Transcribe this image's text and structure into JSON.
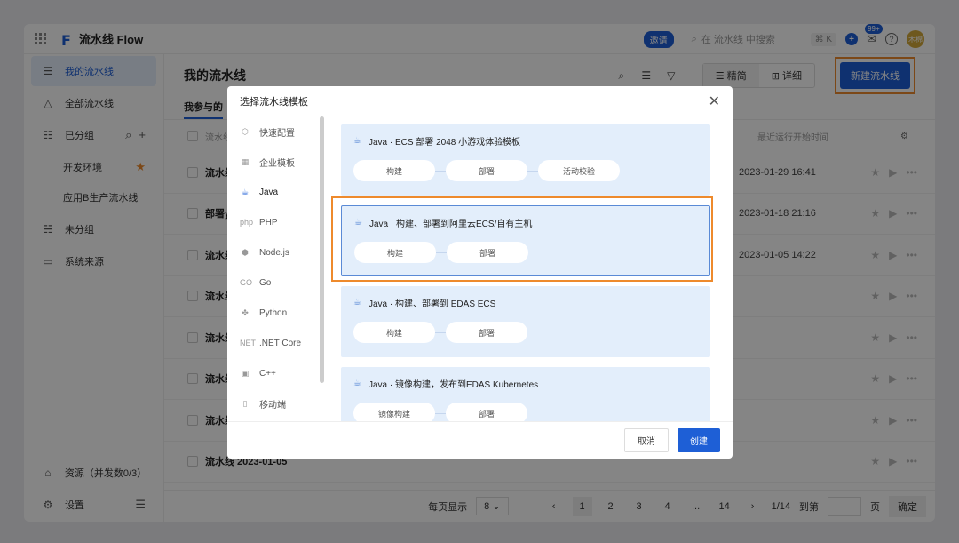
{
  "app": {
    "title": "流水线 Flow"
  },
  "topbar": {
    "invite": "邀请",
    "search_placeholder": "在 流水线 中搜索",
    "shortcut": "⌘ K",
    "notif_count": "99+",
    "avatar_text": "木棉"
  },
  "sidebar": {
    "items": [
      {
        "label": "我的流水线"
      },
      {
        "label": "全部流水线"
      },
      {
        "label": "已分组"
      },
      {
        "label": "开发环境"
      },
      {
        "label": "应用B生产流水线"
      },
      {
        "label": "未分组"
      },
      {
        "label": "系统来源"
      }
    ],
    "resource_label": "资源（并发数0/3）",
    "settings_label": "设置"
  },
  "main": {
    "title": "我的流水线",
    "view_simple": "精简",
    "view_detail": "详细",
    "new_button": "新建流水线",
    "tab_participate": "我参与的",
    "col_name": "流水线",
    "col_last_run": "最近运行开始时间",
    "rows": [
      {
        "name": "流水线",
        "time": "2023-01-29 16:41"
      },
      {
        "name": "部署y",
        "time": "2023-01-18 21:16"
      },
      {
        "name": "流水线",
        "time": "2023-01-05 14:22"
      },
      {
        "name": "流水线",
        "time": ""
      },
      {
        "name": "流水线",
        "time": ""
      },
      {
        "name": "流水线",
        "time": ""
      },
      {
        "name": "流水线",
        "time": ""
      },
      {
        "name": "流水线 2023-01-05",
        "time": ""
      }
    ],
    "pagination": {
      "page_size_label": "每页显示",
      "page_size": "8",
      "pages": [
        "1",
        "2",
        "3",
        "4",
        "...",
        "14"
      ],
      "page_info": "1/14",
      "jump_label": "到第",
      "page_unit": "页",
      "confirm": "确定"
    }
  },
  "modal": {
    "title": "选择流水线模板",
    "categories": [
      {
        "label": "快速配置",
        "icon": "⬡"
      },
      {
        "label": "企业模板",
        "icon": "▦"
      },
      {
        "label": "Java",
        "icon": "☕"
      },
      {
        "label": "PHP",
        "icon": "php"
      },
      {
        "label": "Node.js",
        "icon": "⬢"
      },
      {
        "label": "Go",
        "icon": "GO"
      },
      {
        "label": "Python",
        "icon": "✤"
      },
      {
        "label": ".NET Core",
        "icon": "NET"
      },
      {
        "label": "C++",
        "icon": "▣"
      },
      {
        "label": "移动端",
        "icon": "▯"
      }
    ],
    "templates": [
      {
        "title": "Java · ECS 部署 2048 小游戏体验模板",
        "steps": [
          "构建",
          "部署",
          "活动校验"
        ]
      },
      {
        "title": "Java · 构建、部署到阿里云ECS/自有主机",
        "steps": [
          "构建",
          "部署"
        ]
      },
      {
        "title": "Java · 构建、部署到 EDAS ECS",
        "steps": [
          "构建",
          "部署"
        ]
      },
      {
        "title": "Java · 镜像构建，发布到EDAS Kubernetes",
        "steps": [
          "镜像构建",
          "部署"
        ]
      }
    ],
    "cancel": "取消",
    "create": "创建"
  }
}
